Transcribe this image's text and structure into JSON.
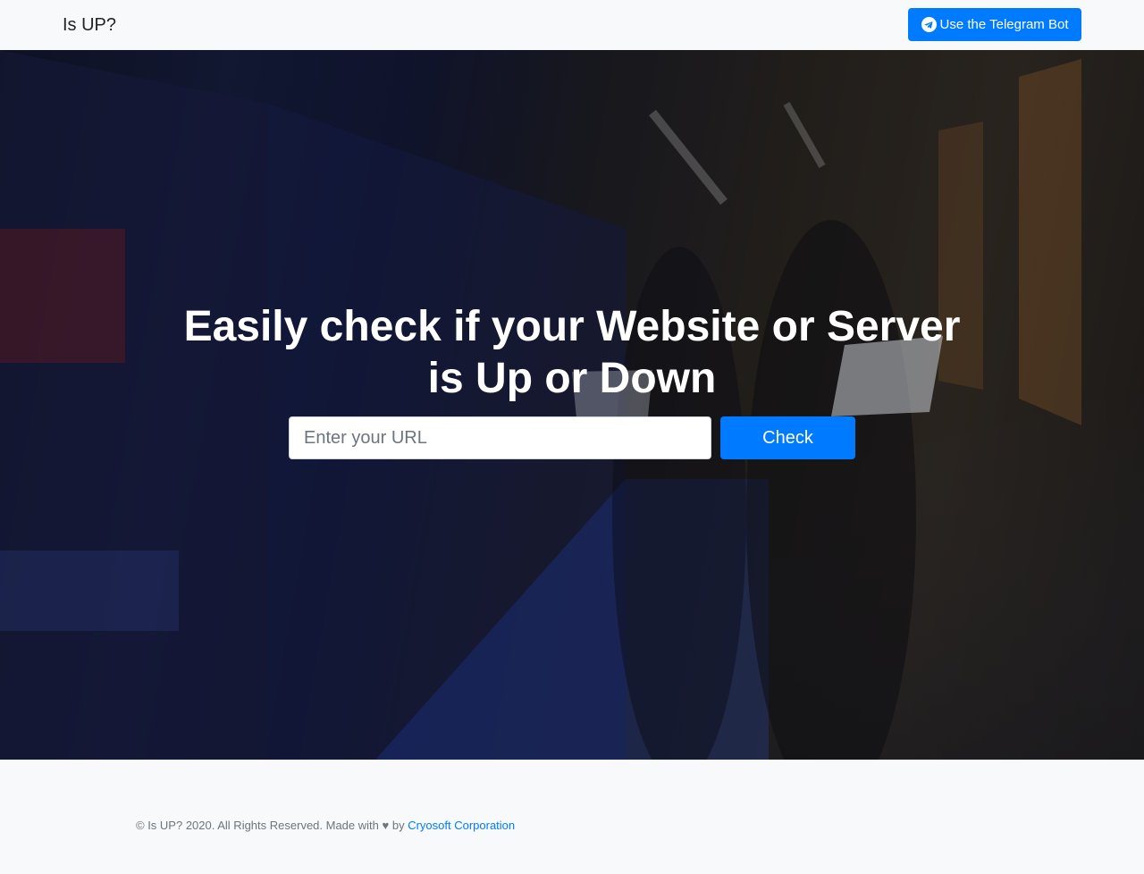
{
  "navbar": {
    "brand": "Is UP?",
    "telegram_button": {
      "label": "Use the Telegram Bot",
      "icon": "telegram-icon"
    }
  },
  "hero": {
    "headline_line1": "Easily check if your Website or Server",
    "headline_line2": "is Up or Down",
    "url_input": {
      "placeholder": "Enter your URL",
      "value": ""
    },
    "check_button": "Check"
  },
  "footer": {
    "text_before": "© Is UP? 2020. All Rights Reserved. Made with",
    "heart": "♥",
    "by": "by",
    "link_text": "Cryosoft Corporation"
  },
  "colors": {
    "primary": "#007bff",
    "background": "#f8f9fa",
    "text_muted": "#6c757d"
  }
}
